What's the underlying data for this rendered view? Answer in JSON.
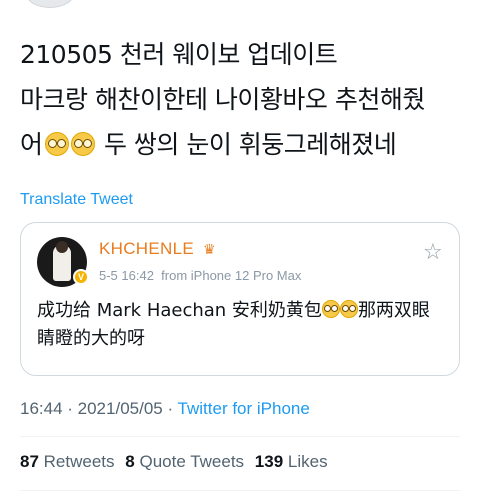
{
  "tweet": {
    "lines": [
      "210505 천러 웨이보 업데이트",
      "마크랑 해찬이한테 나이황바오 추천해줬",
      "어",
      "두 쌍의 눈이 휘둥그레해졌네"
    ],
    "emoji": "face-with-monocle-icon"
  },
  "translate_label": "Translate Tweet",
  "quote": {
    "name": "KHCHENLE",
    "date": "5-5 16:42",
    "source": "from iPhone 12 Pro Max",
    "verified_badge": "V",
    "text_line1a": "成功给 Mark Haechan 安利奶黄包",
    "text_line1b": "那两双眼",
    "text_line2": "睛瞪的大的呀"
  },
  "meta": {
    "time": "16:44 · 2021/05/05 · ",
    "source": "Twitter for iPhone"
  },
  "stats": {
    "retweets_count": "87",
    "retweets_label": "Retweets",
    "quotes_count": "8",
    "quotes_label": "Quote Tweets",
    "likes_count": "139",
    "likes_label": "Likes"
  },
  "colors": {
    "link": "#1d9bf0",
    "name": "#e87c1e",
    "muted": "#536471"
  }
}
